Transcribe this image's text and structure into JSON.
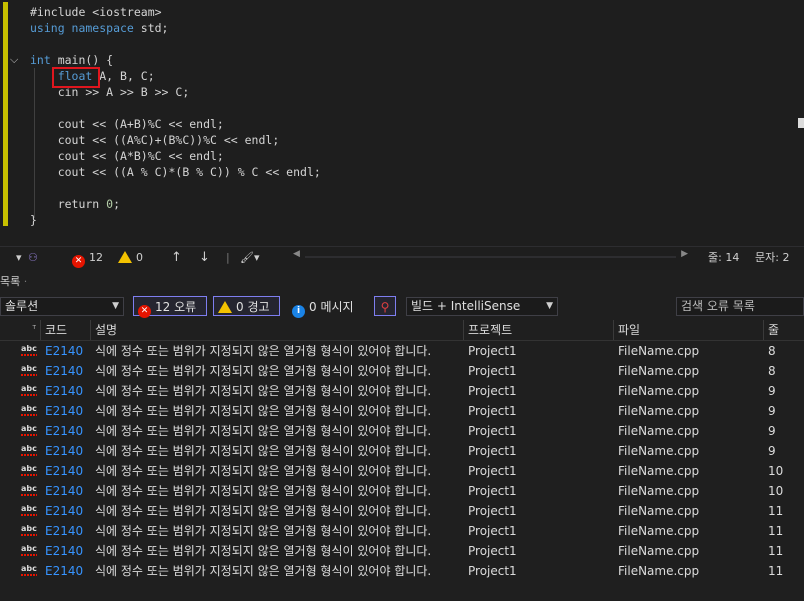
{
  "editor": {
    "lines": [
      {
        "tokens": [
          {
            "t": "#include <iostream>",
            "c": "plain"
          }
        ]
      },
      {
        "tokens": [
          {
            "t": "using namespace",
            "c": "kw"
          },
          {
            "t": " std;",
            "c": "plain"
          }
        ]
      },
      {
        "tokens": [
          {
            "t": "",
            "c": "plain"
          }
        ]
      },
      {
        "tokens": [
          {
            "t": "int",
            "c": "kw"
          },
          {
            "t": " main() {",
            "c": "plain"
          }
        ]
      },
      {
        "tokens": [
          {
            "t": "    ",
            "c": "plain"
          },
          {
            "t": "float",
            "c": "kw"
          },
          {
            "t": " A, B, C;",
            "c": "plain"
          }
        ]
      },
      {
        "tokens": [
          {
            "t": "    cin >> A >> B >> C;",
            "c": "plain"
          }
        ]
      },
      {
        "tokens": [
          {
            "t": "",
            "c": "plain"
          }
        ]
      },
      {
        "tokens": [
          {
            "t": "    cout << (A+B)%C << endl;",
            "c": "plain"
          }
        ]
      },
      {
        "tokens": [
          {
            "t": "    cout << ((A%C)+(B%C))%C << endl;",
            "c": "plain"
          }
        ]
      },
      {
        "tokens": [
          {
            "t": "    cout << (A*B)%C << endl;",
            "c": "plain"
          }
        ]
      },
      {
        "tokens": [
          {
            "t": "    cout << ((A % C)*(B % C)) % C << endl;",
            "c": "plain"
          }
        ]
      },
      {
        "tokens": [
          {
            "t": "",
            "c": "plain"
          }
        ]
      },
      {
        "tokens": [
          {
            "t": "    return ",
            "c": "plain"
          },
          {
            "t": "0",
            "c": "num"
          },
          {
            "t": ";",
            "c": "plain"
          }
        ]
      },
      {
        "tokens": [
          {
            "t": "}",
            "c": "plain"
          }
        ]
      }
    ]
  },
  "status_bar": {
    "error_count": "12",
    "warning_count": "0",
    "line_label": "줄: 14",
    "col_label": "문자: 2"
  },
  "panel": {
    "title": "목록",
    "scope_combo": "솔루션",
    "errors_btn": "12 오류",
    "warnings_btn": "0 경고",
    "messages_btn": "0 메시지",
    "build_combo": "빌드 + IntelliSense",
    "search_placeholder": "검색 오류 목록"
  },
  "table": {
    "headers": {
      "code": "코드",
      "description": "설명",
      "project": "프로젝트",
      "file": "파일",
      "line": "줄"
    },
    "rows": [
      {
        "code": "E2140",
        "description": "식에 정수 또는 범위가 지정되지 않은 열거형 형식이 있어야 합니다.",
        "project": "Project1",
        "file": "FileName.cpp",
        "line": "8"
      },
      {
        "code": "E2140",
        "description": "식에 정수 또는 범위가 지정되지 않은 열거형 형식이 있어야 합니다.",
        "project": "Project1",
        "file": "FileName.cpp",
        "line": "8"
      },
      {
        "code": "E2140",
        "description": "식에 정수 또는 범위가 지정되지 않은 열거형 형식이 있어야 합니다.",
        "project": "Project1",
        "file": "FileName.cpp",
        "line": "9"
      },
      {
        "code": "E2140",
        "description": "식에 정수 또는 범위가 지정되지 않은 열거형 형식이 있어야 합니다.",
        "project": "Project1",
        "file": "FileName.cpp",
        "line": "9"
      },
      {
        "code": "E2140",
        "description": "식에 정수 또는 범위가 지정되지 않은 열거형 형식이 있어야 합니다.",
        "project": "Project1",
        "file": "FileName.cpp",
        "line": "9"
      },
      {
        "code": "E2140",
        "description": "식에 정수 또는 범위가 지정되지 않은 열거형 형식이 있어야 합니다.",
        "project": "Project1",
        "file": "FileName.cpp",
        "line": "9"
      },
      {
        "code": "E2140",
        "description": "식에 정수 또는 범위가 지정되지 않은 열거형 형식이 있어야 합니다.",
        "project": "Project1",
        "file": "FileName.cpp",
        "line": "10"
      },
      {
        "code": "E2140",
        "description": "식에 정수 또는 범위가 지정되지 않은 열거형 형식이 있어야 합니다.",
        "project": "Project1",
        "file": "FileName.cpp",
        "line": "10"
      },
      {
        "code": "E2140",
        "description": "식에 정수 또는 범위가 지정되지 않은 열거형 형식이 있어야 합니다.",
        "project": "Project1",
        "file": "FileName.cpp",
        "line": "11"
      },
      {
        "code": "E2140",
        "description": "식에 정수 또는 범위가 지정되지 않은 열거형 형식이 있어야 합니다.",
        "project": "Project1",
        "file": "FileName.cpp",
        "line": "11"
      },
      {
        "code": "E2140",
        "description": "식에 정수 또는 범위가 지정되지 않은 열거형 형식이 있어야 합니다.",
        "project": "Project1",
        "file": "FileName.cpp",
        "line": "11"
      },
      {
        "code": "E2140",
        "description": "식에 정수 또는 범위가 지정되지 않은 열거형 형식이 있어야 합니다.",
        "project": "Project1",
        "file": "FileName.cpp",
        "line": "11"
      }
    ]
  },
  "icons": {
    "error": "error-circle-icon",
    "warning": "warning-triangle-icon",
    "info": "info-circle-icon",
    "spell": "abc-spell-icon"
  },
  "colors": {
    "background": "#1e1e1e",
    "keyword": "#569cd6",
    "error": "#e51400",
    "warning": "#f3c200",
    "link": "#3794ff",
    "highlight_box": "#e0161e",
    "change_bar": "#c7c000"
  }
}
